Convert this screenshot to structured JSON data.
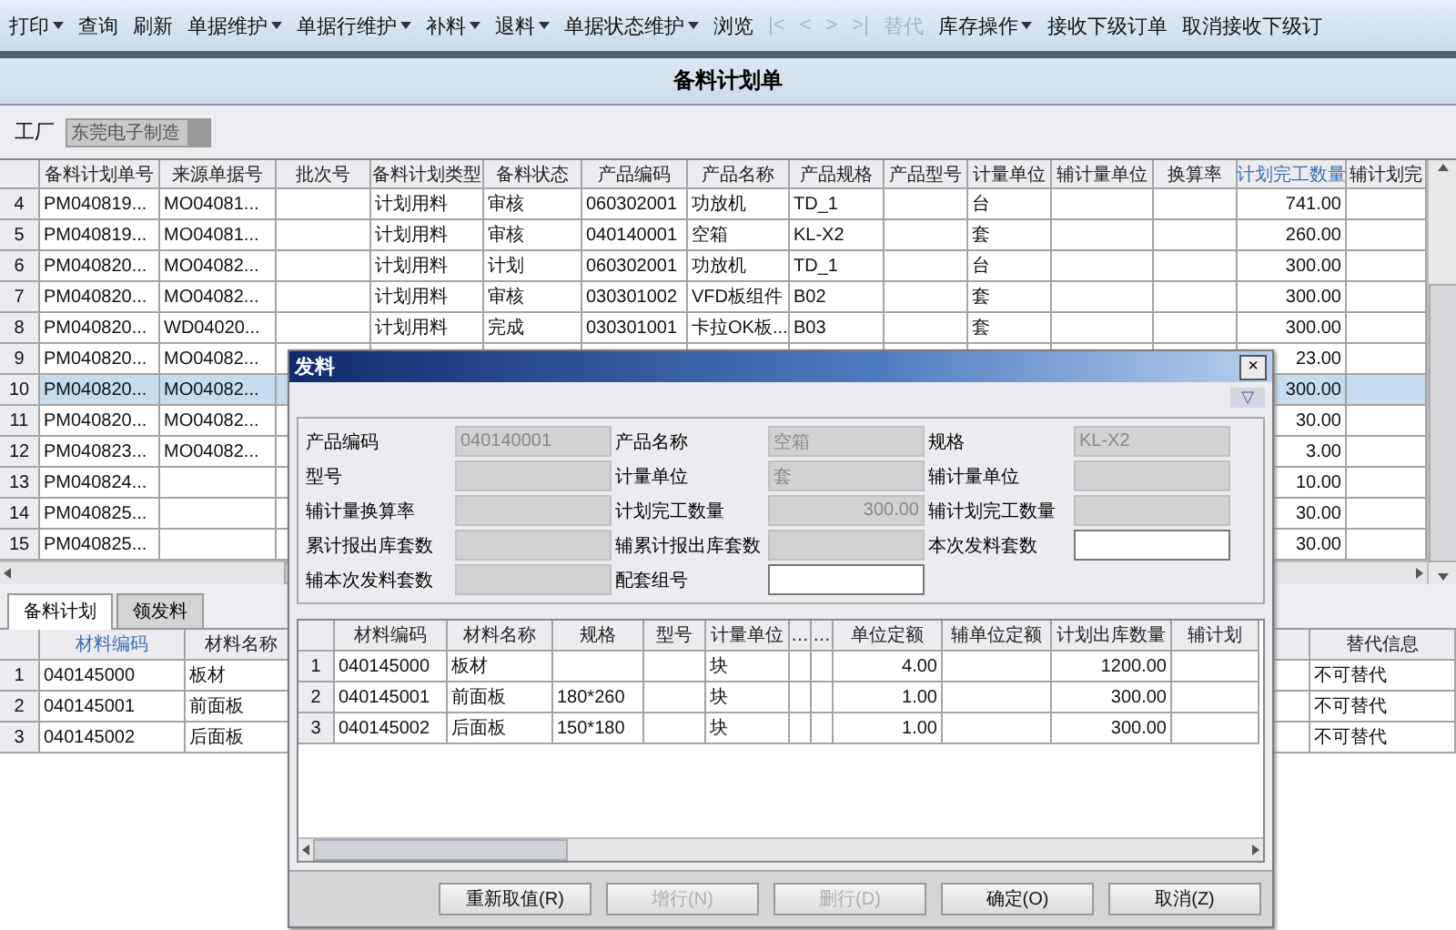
{
  "toolbar": [
    {
      "label": "打印",
      "dropdown": true,
      "disabled": false
    },
    {
      "label": "查询",
      "dropdown": false,
      "disabled": false
    },
    {
      "label": "刷新",
      "dropdown": false,
      "disabled": false
    },
    {
      "label": "单据维护",
      "dropdown": true,
      "disabled": false
    },
    {
      "label": "单据行维护",
      "dropdown": true,
      "disabled": false
    },
    {
      "label": "补料",
      "dropdown": true,
      "disabled": false
    },
    {
      "label": "退料",
      "dropdown": true,
      "disabled": false
    },
    {
      "label": "单据状态维护",
      "dropdown": true,
      "disabled": false
    },
    {
      "label": "浏览",
      "dropdown": false,
      "disabled": false
    },
    {
      "label": "|<",
      "dropdown": false,
      "disabled": true
    },
    {
      "label": "<",
      "dropdown": false,
      "disabled": true
    },
    {
      "label": ">",
      "dropdown": false,
      "disabled": true
    },
    {
      "label": ">|",
      "dropdown": false,
      "disabled": true
    },
    {
      "label": "替代",
      "dropdown": false,
      "disabled": true
    },
    {
      "label": "库存操作",
      "dropdown": true,
      "disabled": false
    },
    {
      "label": "接收下级订单",
      "dropdown": false,
      "disabled": false
    },
    {
      "label": "取消接收下级订",
      "dropdown": false,
      "disabled": false
    }
  ],
  "page_title": "备料计划单",
  "factory": {
    "label": "工厂",
    "value": "东莞电子制造"
  },
  "main_table": {
    "columns": [
      {
        "label": "备料计划单号",
        "kind": "text",
        "highlighted": false
      },
      {
        "label": "来源单据号",
        "kind": "text",
        "highlighted": false
      },
      {
        "label": "批次号",
        "highlighted": false
      },
      {
        "label": "备料计划类型",
        "kind": "text",
        "highlighted": false
      },
      {
        "label": "备料状态",
        "kind": "text",
        "highlighted": false
      },
      {
        "label": "产品编码",
        "kind": "text",
        "highlighted": false
      },
      {
        "label": "产品名称",
        "kind": "text",
        "highlighted": false
      },
      {
        "label": "产品规格",
        "kind": "text",
        "highlighted": false
      },
      {
        "label": "产品型号",
        "highlighted": false
      },
      {
        "label": "计量单位",
        "kind": "text",
        "highlighted": false
      },
      {
        "label": "辅计量单位",
        "highlighted": false
      },
      {
        "label": "换算率",
        "highlighted": false
      },
      {
        "label": "计划完工数量",
        "kind": "number",
        "highlighted": true
      },
      {
        "label": "辅计划完",
        "highlighted": false
      }
    ],
    "rows": [
      {
        "no": "4",
        "selected": false,
        "cells": [
          "PM040819...",
          "MO04081...",
          null,
          "计划用料",
          "审核",
          "060302001",
          "功放机",
          "TD_1",
          null,
          "台",
          null,
          null,
          "741.00",
          null
        ]
      },
      {
        "no": "5",
        "selected": false,
        "cells": [
          "PM040819...",
          "MO04081...",
          null,
          "计划用料",
          "审核",
          "040140001",
          "空箱",
          "KL-X2",
          null,
          "套",
          null,
          null,
          "260.00",
          null
        ]
      },
      {
        "no": "6",
        "selected": false,
        "cells": [
          "PM040820...",
          "MO04082...",
          null,
          "计划用料",
          "计划",
          "060302001",
          "功放机",
          "TD_1",
          null,
          "台",
          null,
          null,
          "300.00",
          null
        ]
      },
      {
        "no": "7",
        "selected": false,
        "cells": [
          "PM040820...",
          "MO04082...",
          null,
          "计划用料",
          "审核",
          "030301002",
          "VFD板组件",
          "B02",
          null,
          "套",
          null,
          null,
          "300.00",
          null
        ]
      },
      {
        "no": "8",
        "selected": false,
        "cells": [
          "PM040820...",
          "WD04020...",
          null,
          "计划用料",
          "完成",
          "030301001",
          "卡拉OK板...",
          "B03",
          null,
          "套",
          null,
          null,
          "300.00",
          null
        ]
      },
      {
        "no": "9",
        "selected": false,
        "cells": [
          "PM040820...",
          "MO04082...",
          null,
          null,
          null,
          null,
          null,
          null,
          null,
          null,
          null,
          null,
          "23.00",
          null
        ]
      },
      {
        "no": "10",
        "selected": true,
        "cells": [
          "PM040820...",
          "MO04082...",
          null,
          null,
          null,
          null,
          null,
          null,
          null,
          null,
          null,
          null,
          "300.00",
          null
        ]
      },
      {
        "no": "11",
        "selected": false,
        "cells": [
          "PM040820...",
          "MO04082...",
          null,
          null,
          null,
          null,
          null,
          null,
          null,
          null,
          null,
          null,
          "30.00",
          null
        ]
      },
      {
        "no": "12",
        "selected": false,
        "cells": [
          "PM040823...",
          "MO04082...",
          null,
          null,
          null,
          null,
          null,
          null,
          null,
          null,
          null,
          null,
          "3.00",
          null
        ]
      },
      {
        "no": "13",
        "selected": false,
        "cells": [
          "PM040824...",
          null,
          null,
          null,
          null,
          null,
          null,
          null,
          null,
          null,
          null,
          null,
          "10.00",
          null
        ]
      },
      {
        "no": "14",
        "selected": false,
        "cells": [
          "PM040825...",
          null,
          null,
          null,
          null,
          null,
          null,
          null,
          null,
          null,
          null,
          null,
          "30.00",
          null
        ]
      },
      {
        "no": "15",
        "selected": false,
        "cells": [
          "PM040825...",
          null,
          null,
          null,
          null,
          null,
          null,
          null,
          null,
          null,
          null,
          null,
          "30.00",
          null
        ]
      }
    ]
  },
  "tabs": [
    {
      "label": "备料计划",
      "selected": true
    },
    {
      "label": "领发料",
      "selected": false
    }
  ],
  "bottom_table": {
    "columns": [
      {
        "label": "材料编码",
        "highlighted": true
      },
      {
        "label": "材料名称",
        "highlighted": false
      },
      {
        "label": "替代信息",
        "highlighted": false
      }
    ],
    "rows": [
      {
        "no": "1",
        "code": "040145000",
        "name": "板材",
        "substitute": "不可替代"
      },
      {
        "no": "2",
        "code": "040145001",
        "name": "前面板",
        "substitute": "不可替代"
      },
      {
        "no": "3",
        "code": "040145002",
        "name": "后面板",
        "substitute": "不可替代"
      }
    ]
  },
  "dialog": {
    "title": "发料",
    "close": "×",
    "expander": "▽",
    "fields": [
      {
        "label": "产品编码",
        "value": "040140001",
        "kind": "text",
        "editable": false
      },
      {
        "label": "产品名称",
        "value": "空箱",
        "kind": "text",
        "editable": false
      },
      {
        "label": "规格",
        "value": "KL-X2",
        "kind": "text",
        "editable": false
      },
      {
        "label": "型号",
        "kind": "text",
        "editable": false
      },
      {
        "label": "计量单位",
        "value": "套",
        "kind": "text",
        "editable": false
      },
      {
        "label": "辅计量单位",
        "kind": "text",
        "editable": false
      },
      {
        "label": "辅计量换算率",
        "kind": "text",
        "editable": false
      },
      {
        "label": "计划完工数量",
        "value": "300.00",
        "kind": "number",
        "editable": false
      },
      {
        "label": "辅计划完工数量",
        "kind": "text",
        "editable": false
      },
      {
        "label": "累计报出库套数",
        "kind": "text",
        "editable": false
      },
      {
        "label": "辅累计报出库套数",
        "kind": "text",
        "editable": false
      },
      {
        "label": "本次发料套数",
        "kind": "text",
        "editable": true
      },
      {
        "label": "辅本次发料套数",
        "kind": "text",
        "editable": false
      },
      {
        "label": "配套组号",
        "kind": "text",
        "editable": true
      }
    ],
    "grid": {
      "columns": [
        {
          "label": "材料编码",
          "kind": "text"
        },
        {
          "label": "材料名称",
          "kind": "text"
        },
        {
          "label": "规格",
          "kind": "text"
        },
        {
          "label": "型号"
        },
        {
          "label": "计量单位",
          "kind": "text"
        },
        {
          "label": "…"
        },
        {
          "label": "…"
        },
        {
          "label": "单位定额",
          "kind": "number"
        },
        {
          "label": "辅单位定额"
        },
        {
          "label": "计划出库数量",
          "kind": "number"
        },
        {
          "label": "辅计划"
        }
      ],
      "rows": [
        {
          "no": "1",
          "cells": [
            "040145000",
            "板材",
            null,
            null,
            "块",
            null,
            null,
            "4.00",
            null,
            "1200.00",
            null
          ]
        },
        {
          "no": "2",
          "cells": [
            "040145001",
            "前面板",
            "180*260",
            null,
            "块",
            null,
            null,
            "1.00",
            null,
            "300.00",
            null
          ]
        },
        {
          "no": "3",
          "cells": [
            "040145002",
            "后面板",
            "150*180",
            null,
            "块",
            null,
            null,
            "1.00",
            null,
            "300.00",
            null
          ]
        }
      ]
    },
    "buttons": [
      {
        "label": "重新取值(R)",
        "disabled": false
      },
      {
        "label": "增行(N)",
        "disabled": true
      },
      {
        "label": "删行(D)",
        "disabled": true
      },
      {
        "label": "确定(O)",
        "disabled": false
      },
      {
        "label": "取消(Z)",
        "disabled": false
      }
    ]
  }
}
